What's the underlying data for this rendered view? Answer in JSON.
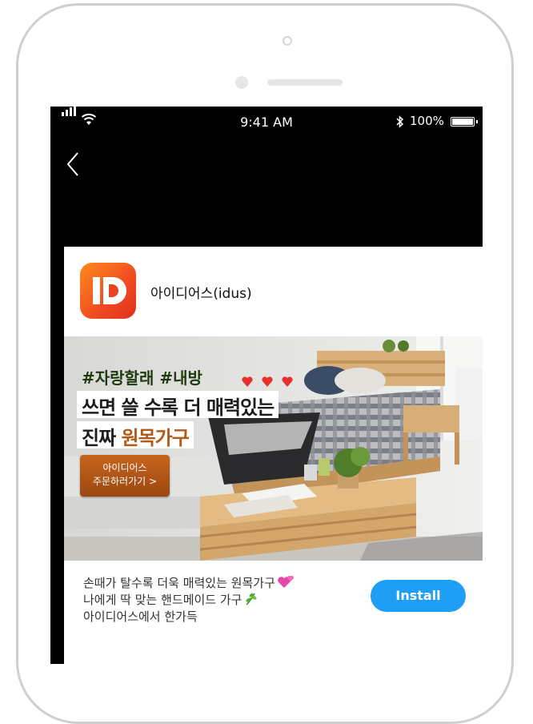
{
  "status_bar": {
    "time": "9:41 AM",
    "battery": "100%",
    "icons": [
      "signal-icon",
      "wifi-icon",
      "bluetooth-icon",
      "battery-icon"
    ]
  },
  "navigation": {
    "back_icon": "chevron-left-icon"
  },
  "ad": {
    "app_name": "아이디어스(idus)",
    "banner": {
      "hashtags": "#자랑할래 #내방",
      "headline_1": "쓰면 쓸 수록 더 매력있는",
      "headline_2_prefix": "진짜 ",
      "headline_2_highlight": "원목가구",
      "button_line_1": "아이디어스",
      "button_line_2": "주문하러가기 >"
    },
    "description": [
      "손때가 탈수록 더욱 매력있는 원목가구",
      "나에게 딱 맞는 핸드메이드 가구",
      "아이디어스에서 한가득"
    ],
    "install_label": "Install"
  },
  "colors": {
    "install_button": "#1e9ef5",
    "app_icon_gradient_start": "#ff8a1d",
    "app_icon_gradient_end": "#e0301b",
    "screen_background": "#000000"
  }
}
